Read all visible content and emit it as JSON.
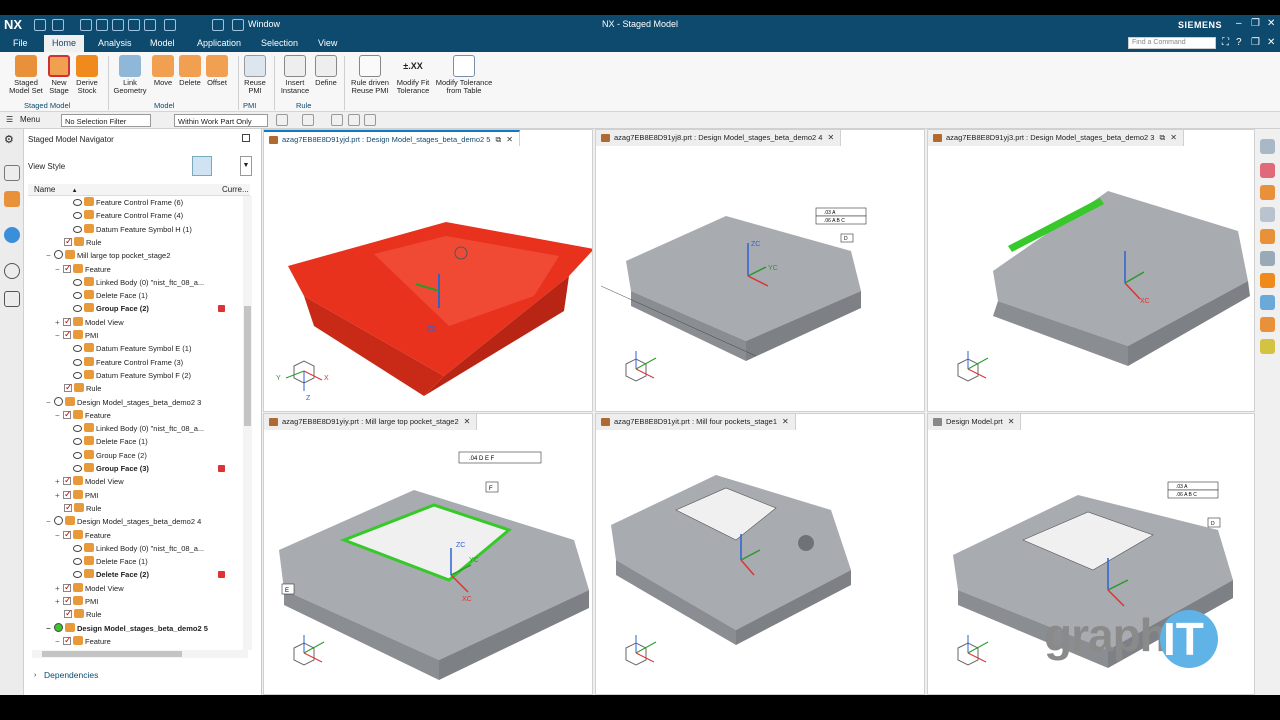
{
  "app": {
    "logo": "NX",
    "title": "NX - Staged Model",
    "brand": "SIEMENS",
    "window_menu": "Window",
    "search_placeholder": "Find a Command"
  },
  "menu": {
    "items": [
      "File",
      "Home",
      "Analysis",
      "Model",
      "Application",
      "Selection",
      "View"
    ],
    "active": "Home"
  },
  "ribbon": {
    "buttons": [
      {
        "label": "Staged\nModel Set",
        "icon": "staged-model-set-icon"
      },
      {
        "label": "New\nStage",
        "icon": "new-stage-icon"
      },
      {
        "label": "Derive\nStock",
        "icon": "derive-stock-icon"
      },
      {
        "label": "Link\nGeometry",
        "icon": "link-geometry-icon"
      },
      {
        "label": "Move",
        "icon": "move-icon"
      },
      {
        "label": "Delete",
        "icon": "delete-icon"
      },
      {
        "label": "Offset",
        "icon": "offset-icon"
      },
      {
        "label": "Reuse\nPMI",
        "icon": "reuse-pmi-icon"
      },
      {
        "label": "Insert\nInstance",
        "icon": "insert-instance-icon"
      },
      {
        "label": "Define",
        "icon": "define-icon"
      },
      {
        "label": "Rule driven\nReuse PMI",
        "icon": "rule-reuse-pmi-icon"
      },
      {
        "label": "Modify Fit\nTolerance",
        "icon": "modify-fit-tolerance-icon"
      },
      {
        "label": "Modify Tolerance\nfrom Table",
        "icon": "modify-tolerance-table-icon"
      }
    ],
    "groups": [
      "Staged Model",
      "Model",
      "PMI",
      "Rule"
    ],
    "fit_symbol": "±.XX"
  },
  "selection_bar": {
    "menu_label": "Menu",
    "filter": "No Selection Filter",
    "scope": "Within Work Part Only"
  },
  "navigator": {
    "title": "Staged Model Navigator",
    "view_style": "View Style",
    "col_name": "Name",
    "col_current": "Curre...",
    "dependencies": "Dependencies",
    "rows": [
      {
        "indent": 5,
        "type": "eye",
        "text": "Feature Control Frame (6)"
      },
      {
        "indent": 5,
        "type": "eye",
        "text": "Feature Control Frame (4)"
      },
      {
        "indent": 5,
        "type": "eye",
        "text": "Datum Feature Symbol H (1)"
      },
      {
        "indent": 4,
        "type": "cb",
        "text": "Rule"
      },
      {
        "indent": 2,
        "type": "stage",
        "text": "Mill large top pocket_stage2",
        "pm": "−"
      },
      {
        "indent": 3,
        "type": "cbf",
        "text": "Feature",
        "pm": "−"
      },
      {
        "indent": 5,
        "type": "eye",
        "text": "Linked Body (0) \"nist_ftc_08_a..."
      },
      {
        "indent": 5,
        "type": "eye",
        "text": "Delete Face (1)"
      },
      {
        "indent": 5,
        "type": "eye",
        "text": "Group Face (2)",
        "bold": true,
        "flag": true
      },
      {
        "indent": 3,
        "type": "cb",
        "text": "Model View",
        "pm": "+"
      },
      {
        "indent": 3,
        "type": "cb",
        "text": "PMI",
        "pm": "−"
      },
      {
        "indent": 5,
        "type": "eye",
        "text": "Datum Feature Symbol E (1)"
      },
      {
        "indent": 5,
        "type": "eye",
        "text": "Feature Control Frame (3)"
      },
      {
        "indent": 5,
        "type": "eye",
        "text": "Datum Feature Symbol F (2)"
      },
      {
        "indent": 4,
        "type": "cb",
        "text": "Rule"
      },
      {
        "indent": 2,
        "type": "stage",
        "text": "Design Model_stages_beta_demo2 3",
        "pm": "−"
      },
      {
        "indent": 3,
        "type": "cbf",
        "text": "Feature",
        "pm": "−"
      },
      {
        "indent": 5,
        "type": "eye",
        "text": "Linked Body (0) \"nist_ftc_08_a..."
      },
      {
        "indent": 5,
        "type": "eye",
        "text": "Delete Face (1)"
      },
      {
        "indent": 5,
        "type": "eye",
        "text": "Group Face (2)"
      },
      {
        "indent": 5,
        "type": "eye",
        "text": "Group Face (3)",
        "bold": true,
        "flag": true
      },
      {
        "indent": 3,
        "type": "cb",
        "text": "Model View",
        "pm": "+"
      },
      {
        "indent": 3,
        "type": "cb",
        "text": "PMI",
        "pm": "+"
      },
      {
        "indent": 4,
        "type": "cb",
        "text": "Rule"
      },
      {
        "indent": 2,
        "type": "stage",
        "text": "Design Model_stages_beta_demo2 4",
        "pm": "−"
      },
      {
        "indent": 3,
        "type": "cbf",
        "text": "Feature",
        "pm": "−"
      },
      {
        "indent": 5,
        "type": "eye",
        "text": "Linked Body (0) \"nist_ftc_08_a..."
      },
      {
        "indent": 5,
        "type": "eye",
        "text": "Delete Face (1)"
      },
      {
        "indent": 5,
        "type": "eye",
        "text": "Delete Face (2)",
        "bold": true,
        "flag": true
      },
      {
        "indent": 3,
        "type": "cb",
        "text": "Model View",
        "pm": "+"
      },
      {
        "indent": 3,
        "type": "cb",
        "text": "PMI",
        "pm": "+"
      },
      {
        "indent": 4,
        "type": "cb",
        "text": "Rule"
      },
      {
        "indent": 2,
        "type": "stagecur",
        "text": "Design Model_stages_beta_demo2 5",
        "bold": true,
        "pm": "−"
      },
      {
        "indent": 3,
        "type": "cbf",
        "text": "Feature",
        "pm": "−"
      }
    ]
  },
  "viewports": [
    {
      "tab": "azag7EB8E8D91yjd.prt : Design Model_stages_beta_demo2 5",
      "active": true
    },
    {
      "tab": "azag7EB8E8D91yj8.prt : Design Model_stages_beta_demo2 4"
    },
    {
      "tab": "azag7EB8E8D91yj3.prt : Design Model_stages_beta_demo2 3"
    },
    {
      "tab": "azag7EB8E8D91yiy.prt : Mill large top pocket_stage2"
    },
    {
      "tab": "azag7EB8E8D91yit.prt : Mill four pockets_stage1"
    },
    {
      "tab": "Design Model.prt"
    }
  ],
  "annotations": {
    "zc": "ZC",
    "yc": "YC",
    "xc": "XC",
    "x": "X",
    "y": "Y",
    "z": "Z",
    "fcf1": ".04 D E F",
    "datum_f": "F",
    "datum_e": "E",
    "datum_d": "D",
    "fcf_a1": ".03 A",
    "fcf_a2": ".06 A B C"
  },
  "watermark": {
    "text": "graph",
    "it": "IT"
  },
  "colors": {
    "nx_blue": "#0e4a6e",
    "part_gray": "#a8acb0",
    "stage_red": "#e8321e",
    "face_green": "#37c82a",
    "accent": "#0e7ac4"
  }
}
